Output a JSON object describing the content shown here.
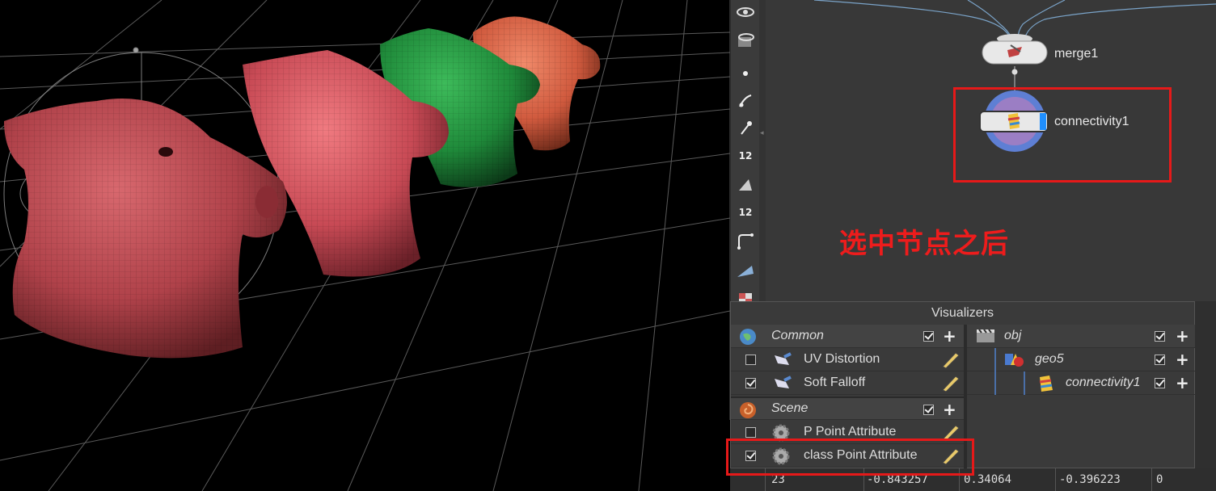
{
  "network": {
    "nodes": [
      {
        "name": "merge1"
      },
      {
        "name": "connectivity1"
      }
    ],
    "annotation": "选中节点之后"
  },
  "visualizers": {
    "title": "Visualizers",
    "common": {
      "label": "Common",
      "checked": true,
      "items": [
        {
          "label": "UV Distortion",
          "checked": false
        },
        {
          "label": "Soft Falloff",
          "checked": true
        }
      ]
    },
    "scene": {
      "label": "Scene",
      "checked": true,
      "items": [
        {
          "label": "P Point Attribute",
          "checked": false
        },
        {
          "label": "class Point Attribute",
          "checked": true
        }
      ]
    },
    "tree": [
      {
        "label": "obj",
        "checked": true
      },
      {
        "label": "geo5",
        "checked": true
      },
      {
        "label": "connectivity1",
        "checked": true
      }
    ]
  },
  "spreadsheet_row": {
    "cells": [
      "23",
      "-0.843257",
      "0.34064",
      "-0.396223",
      "0"
    ]
  },
  "shelf": {
    "number_labels": [
      "12",
      "12"
    ]
  },
  "colors": {
    "annotation": "#ee1c1c",
    "highlight_box": "#e61919",
    "network_bg": "#383838",
    "viewport_bg": "#000000"
  }
}
